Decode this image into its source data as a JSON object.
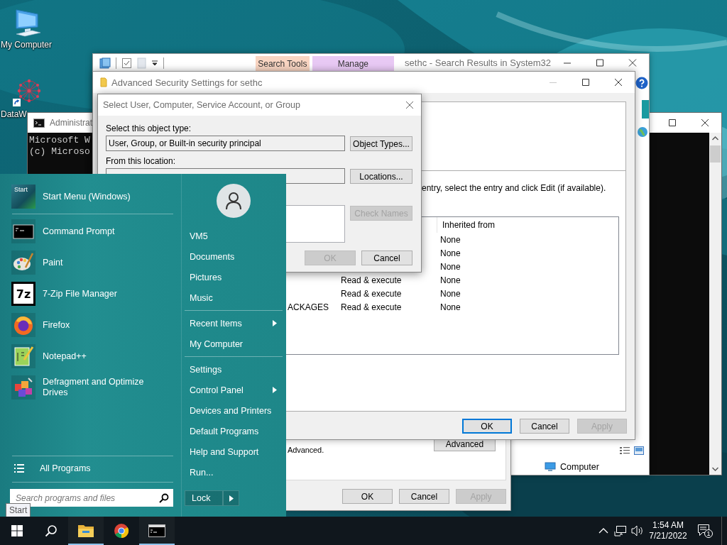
{
  "desktop_icons": [
    {
      "label": "My Computer",
      "kind": "computer"
    },
    {
      "label": "DataW",
      "kind": "network"
    }
  ],
  "console_window": {
    "title": "Administrat",
    "header_lines": [
      "Microsoft W",
      "(c) Microso"
    ]
  },
  "explorer_window": {
    "title": "sethc - Search Results in System32",
    "context_tabs": [
      {
        "label": "Search Tools",
        "color": "#f9d5c2"
      },
      {
        "label": "Manage",
        "color": "#e8c9f4"
      }
    ],
    "status_text": "Computer"
  },
  "properties_dialog": {
    "note": "Advanced.",
    "advanced_button": "Advanced",
    "buttons": [
      {
        "label": "OK",
        "disabled": false
      },
      {
        "label": "Cancel",
        "disabled": false
      },
      {
        "label": "Apply",
        "disabled": true
      }
    ]
  },
  "advanced_security": {
    "title": "Advanced Security Settings for sethc",
    "instruction": "entry, select the entry and click Edit (if available).",
    "table": {
      "header": "Inherited from",
      "rows": [
        {
          "inherited_from": "None"
        },
        {
          "inherited_from": "None"
        },
        {
          "inherited_from": "None"
        },
        {
          "access": "Read & execute",
          "inherited_from": "None"
        },
        {
          "access": "Read & execute",
          "inherited_from": "None"
        },
        {
          "principal": "ACKAGES",
          "access": "Read & execute",
          "inherited_from": "None"
        }
      ]
    },
    "buttons": [
      {
        "label": "OK",
        "disabled": false,
        "default": true
      },
      {
        "label": "Cancel",
        "disabled": false,
        "default": false
      },
      {
        "label": "Apply",
        "disabled": true,
        "default": false
      }
    ]
  },
  "select_dialog": {
    "title": "Select User, Computer, Service Account, or Group",
    "object_type_label": "Select this object type:",
    "object_type": "User, Group, or Built-in security principal",
    "object_types_button": "Object Types...",
    "location_label": "From this location:",
    "locations_button": "Locations...",
    "check_names_button": {
      "label": "Check Names",
      "disabled": true
    },
    "buttons": [
      {
        "label": "OK",
        "disabled": true
      },
      {
        "label": "Cancel",
        "disabled": false
      }
    ]
  },
  "start_menu": {
    "pinned": [
      {
        "label": "Start Menu (Windows)",
        "kind": "startmenu",
        "icon_text": "Start"
      }
    ],
    "recent": [
      {
        "label": "Command Prompt",
        "kind": "console"
      },
      {
        "label": "Paint",
        "kind": "paint"
      },
      {
        "label": "7-Zip File Manager",
        "kind": "archive",
        "icon_text": "7z"
      },
      {
        "label": "Firefox",
        "kind": "firefox"
      },
      {
        "label": "Notepad++",
        "kind": "notepad"
      },
      {
        "label": "Defragment and Optimize Drives",
        "kind": "defrag"
      }
    ],
    "all_programs": "All Programs",
    "search_placeholder": "Search programs and files",
    "link_groups": [
      {
        "links": [
          {
            "label": "VM5",
            "submenu": false
          },
          {
            "label": "Documents",
            "submenu": false
          },
          {
            "label": "Pictures",
            "submenu": false
          },
          {
            "label": "Music",
            "submenu": false
          }
        ]
      },
      {
        "links": [
          {
            "label": "Recent Items",
            "submenu": true
          },
          {
            "label": "My Computer",
            "submenu": false
          }
        ]
      },
      {
        "links": [
          {
            "label": "Settings",
            "submenu": false
          },
          {
            "label": "Control Panel",
            "submenu": true
          },
          {
            "label": "Devices and Printers",
            "submenu": false
          },
          {
            "label": "Default Programs",
            "submenu": false
          },
          {
            "label": "Help and Support",
            "submenu": false
          },
          {
            "label": "Run...",
            "submenu": false
          }
        ]
      }
    ],
    "lock_button": "Lock"
  },
  "tooltip": "Start",
  "taskbar": {
    "apps": [
      {
        "kind": "folder",
        "running": true
      },
      {
        "kind": "browser",
        "running": false
      },
      {
        "kind": "console",
        "running": true
      }
    ],
    "time": "1:54 AM",
    "date": "7/21/2022",
    "notification_count": "1"
  }
}
